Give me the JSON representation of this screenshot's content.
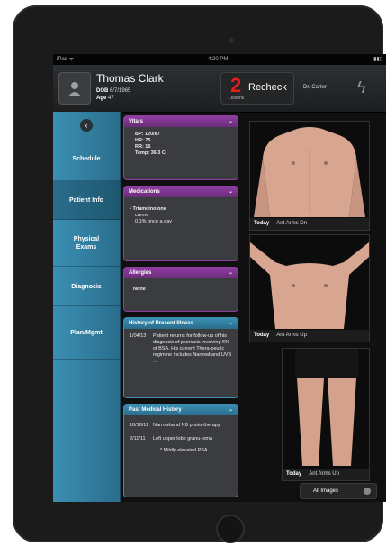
{
  "status": {
    "left": "iPad ᯤ",
    "time": "4:20 PM",
    "right": "▮▮▯"
  },
  "patient": {
    "name": "Thomas Clark",
    "dob_label": "DOB",
    "dob": "6/7/1965",
    "age_label": "Age",
    "age": "47"
  },
  "recheck": {
    "count": "2",
    "sublabel": "Lesions",
    "label": "Recheck"
  },
  "doctor": "Dr. Carter",
  "nav": {
    "back": "‹",
    "items": [
      {
        "label": "Schedule"
      },
      {
        "label": "Patient Info"
      },
      {
        "label": "Physical Exams"
      },
      {
        "label": "Diagnosis"
      },
      {
        "label": "Plan/Mgmt"
      }
    ]
  },
  "cards": {
    "vitals": {
      "title": "Vitals",
      "lines": [
        "BP: 120/87",
        "HR: 75",
        "RR: 16",
        "Temp: 36.3 C"
      ]
    },
    "medications": {
      "title": "Medications",
      "drug": "Triamcinolone",
      "form": "creme",
      "dose": "0.1% once a day"
    },
    "allergies": {
      "title": "Allergies",
      "value": "None"
    },
    "hpi": {
      "title": "History of Present Illness",
      "date": "1/04/13",
      "text": "Patient returns for follow-up of his diagnosis of psoriasis involving 6% of BSA. His current Thera-peutic regimine includes Narrowband UVB ..."
    },
    "pmh": {
      "title": "Past Medical History",
      "entries": [
        {
          "date": "10/10/12",
          "text": "Narrowband NB photo-therapy"
        },
        {
          "date": "2/11/11",
          "text": "Left upper lobe granu-loma"
        }
      ],
      "note": "* Mildly elevated PSA"
    }
  },
  "photos": [
    {
      "day": "Today",
      "label": "Ant Arms Dn"
    },
    {
      "day": "Today",
      "label": "Ant Arms Up"
    },
    {
      "day": "Today",
      "label": "Ant Arms Up"
    }
  ],
  "all_images": "All Images",
  "colors": {
    "accent_blue": "#3b8fb3",
    "accent_purple": "#8e3ea0",
    "recheck_red": "#e41d1d"
  }
}
